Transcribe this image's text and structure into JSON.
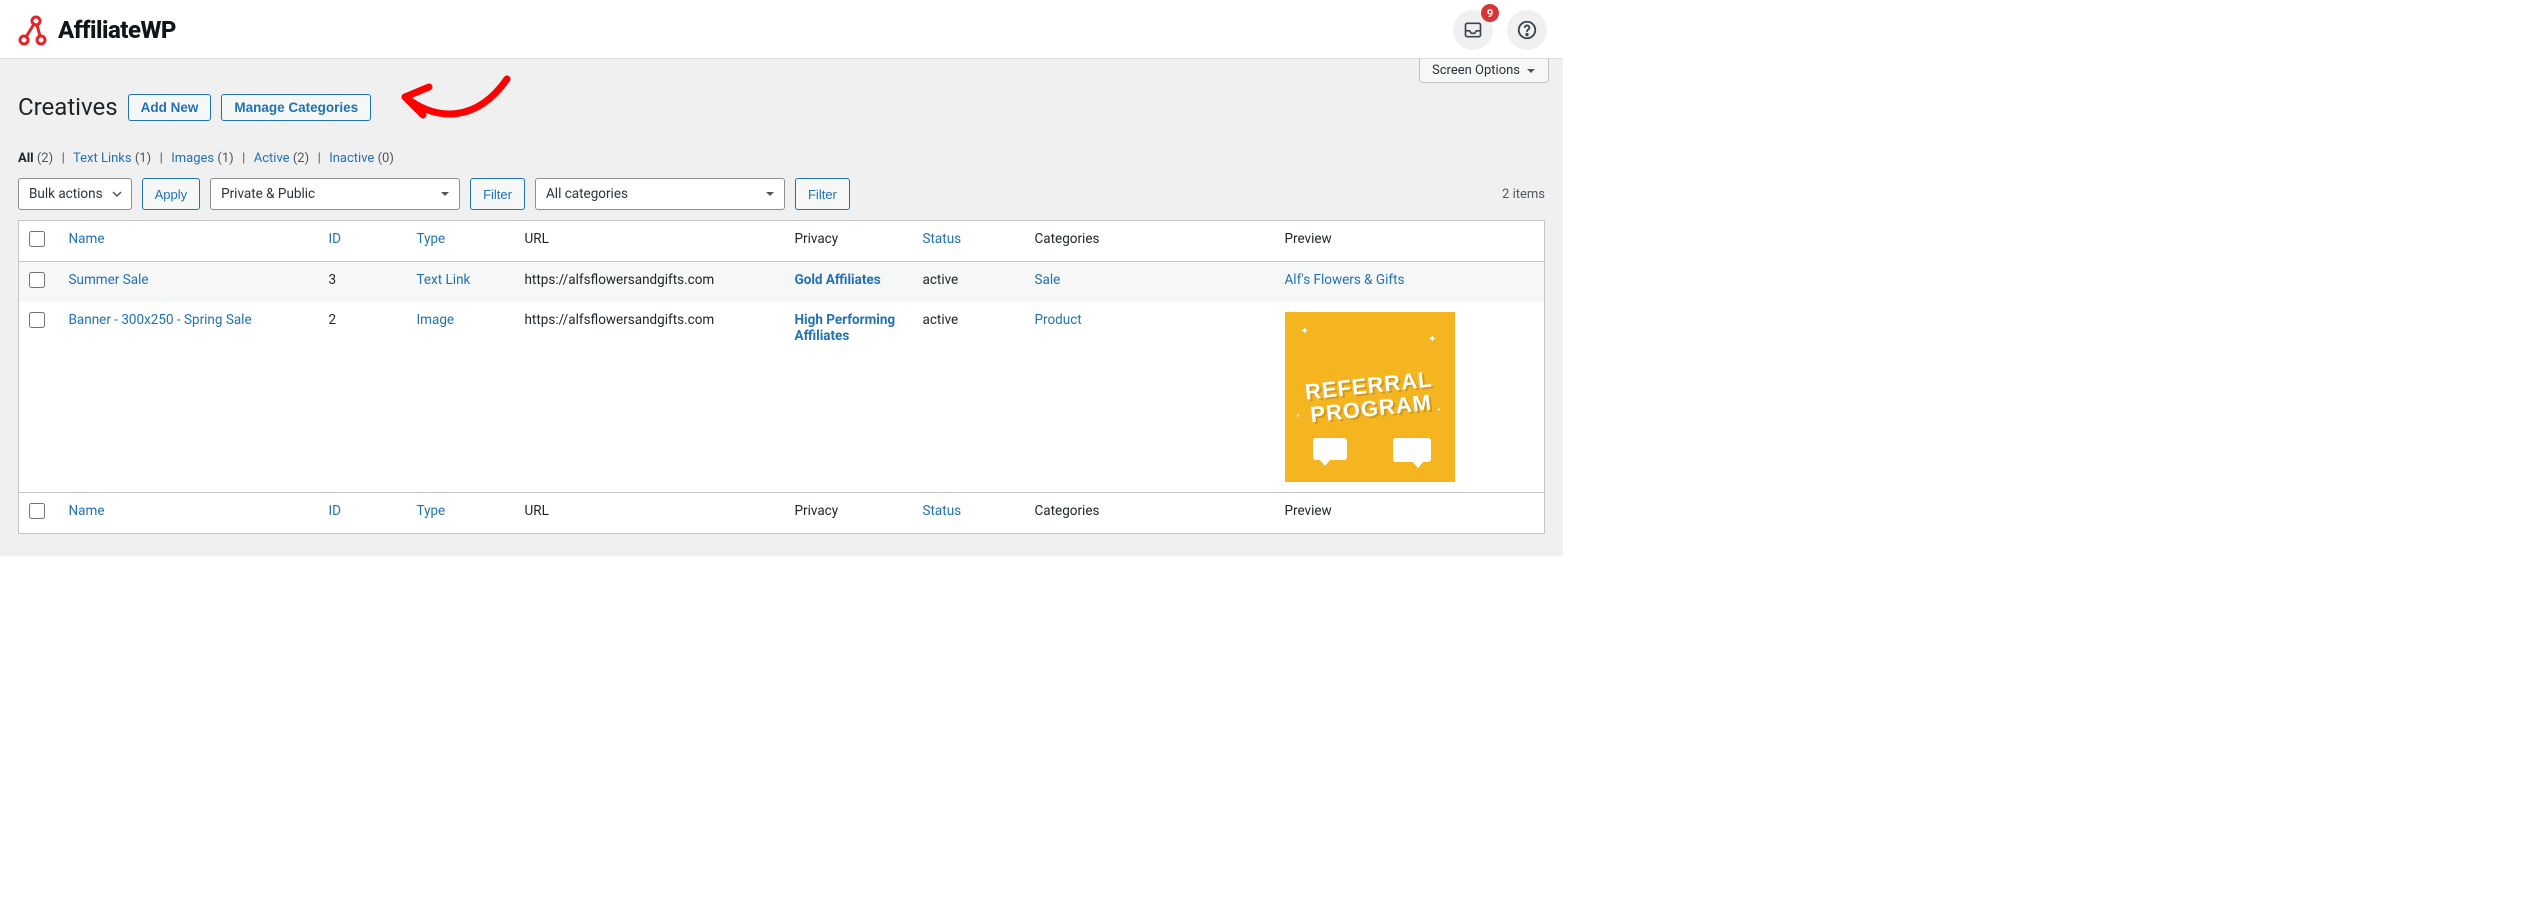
{
  "brand": {
    "name": "AffiliateWP"
  },
  "topbar": {
    "notification_count": "9"
  },
  "screen_options": {
    "label": "Screen Options"
  },
  "heading": {
    "title": "Creatives",
    "add_new": "Add New",
    "manage_categories": "Manage Categories"
  },
  "subsubsub": {
    "all_label": "All",
    "all_count": "(2)",
    "text_links_label": "Text Links",
    "text_links_count": "(1)",
    "images_label": "Images",
    "images_count": "(1)",
    "active_label": "Active",
    "active_count": "(2)",
    "inactive_label": "Inactive",
    "inactive_count": "(0)"
  },
  "filters": {
    "bulk_actions": "Bulk actions",
    "apply": "Apply",
    "privacy_select": "Private & Public",
    "filter1": "Filter",
    "categories_select": "All categories",
    "filter2": "Filter",
    "items_count": "2 items"
  },
  "columns": {
    "name": "Name",
    "id": "ID",
    "type": "Type",
    "url": "URL",
    "privacy": "Privacy",
    "status": "Status",
    "categories": "Categories",
    "preview": "Preview"
  },
  "rows": [
    {
      "name": "Summer Sale",
      "id": "3",
      "type": "Text Link",
      "url": "https://alfsflowersandgifts.com",
      "privacy": "Gold Affiliates",
      "status": "active",
      "categories": "Sale",
      "preview_text": "Alf's Flowers & Gifts",
      "has_image": false
    },
    {
      "name": "Banner - 300x250 - Spring Sale",
      "id": "2",
      "type": "Image",
      "url": "https://alfsflowersandgifts.com",
      "privacy": "High Performing Affiliates",
      "status": "active",
      "categories": "Product",
      "preview_text": "REFERRAL PROGRAM",
      "has_image": true
    }
  ]
}
